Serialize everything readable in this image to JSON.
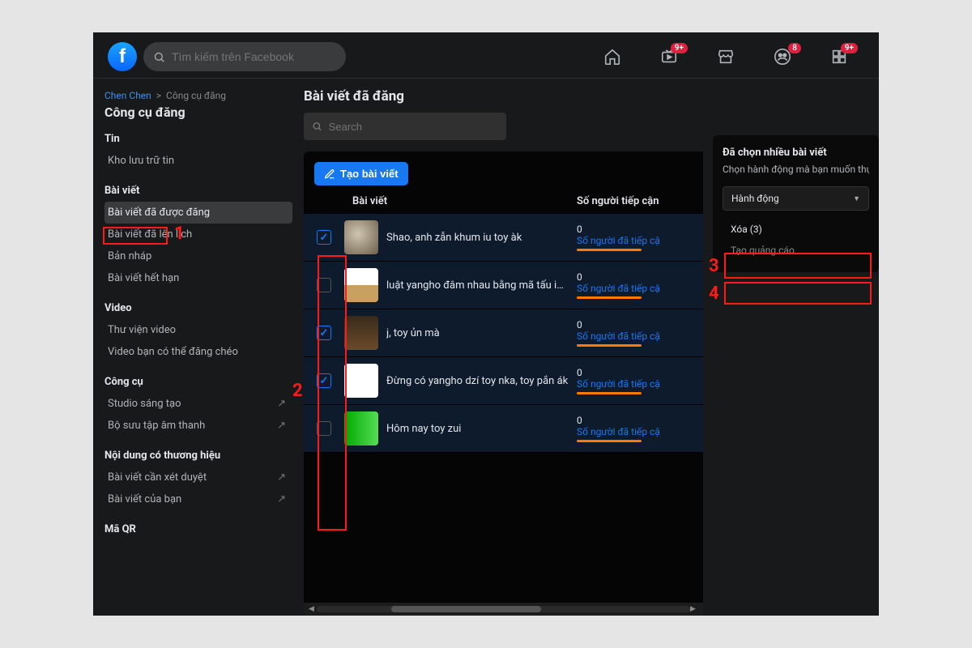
{
  "topbar": {
    "search_placeholder": "Tìm kiếm trên Facebook",
    "badges": {
      "watch": "9+",
      "groups": "8",
      "gaming": "9+"
    }
  },
  "breadcrumb": {
    "first": "Chen Chen",
    "sep": ">",
    "second": "Công cụ đăng"
  },
  "sidebar": {
    "heading": "Công cụ đăng",
    "sections": [
      {
        "title": "Tin",
        "items": [
          {
            "label": "Kho lưu trữ tin"
          }
        ]
      },
      {
        "title": "Bài viết",
        "items": [
          {
            "label": "Bài viết đã được đăng",
            "active": true
          },
          {
            "label": "Bài viết đã lên lịch"
          },
          {
            "label": "Bản nháp"
          },
          {
            "label": "Bài viết hết hạn"
          }
        ]
      },
      {
        "title": "Video",
        "items": [
          {
            "label": "Thư viện video"
          },
          {
            "label": "Video bạn có thể đăng chéo"
          }
        ]
      },
      {
        "title": "Công cụ",
        "items": [
          {
            "label": "Studio sáng tạo",
            "ext": true
          },
          {
            "label": "Bộ sưu tập âm thanh",
            "ext": true
          }
        ]
      },
      {
        "title": "Nội dung có thương hiệu",
        "items": [
          {
            "label": "Bài viết cần xét duyệt",
            "ext": true
          },
          {
            "label": "Bài viết của bạn",
            "ext": true
          }
        ]
      },
      {
        "title": "Mã QR",
        "items": []
      }
    ]
  },
  "main": {
    "page_title": "Bài viết đã đăng",
    "search_placeholder": "Search",
    "create_button": "Tạo bài viết",
    "table": {
      "col_post": "Bài viết",
      "col_reach": "Số người tiếp cận",
      "reach_label": "Số người đã tiếp cậ",
      "rows": [
        {
          "checked": true,
          "title": "Shao, anh zẫn khum iu toy àk",
          "reach": "0"
        },
        {
          "checked": false,
          "title": "luật yangho đâm nhau bằng mã tấu iem iu anh đâ...",
          "reach": "0"
        },
        {
          "checked": true,
          "title": "j, toy ủn mà",
          "reach": "0"
        },
        {
          "checked": true,
          "title": "Đừng có yangho dzí toy nka, toy pắn ák",
          "reach": "0"
        },
        {
          "checked": false,
          "title": "Hôm nay toy zui",
          "reach": "0"
        }
      ]
    }
  },
  "right_panel": {
    "title": "Đã chọn nhiều bài viết",
    "subtitle": "Chọn hành động mà bạn muốn thự",
    "action_label": "Hành động",
    "delete_label": "Xóa (3)",
    "create_ad_label": "Tạo quảng cáo..."
  },
  "annotations": {
    "a1": "1",
    "a2": "2",
    "a3": "3",
    "a4": "4"
  }
}
